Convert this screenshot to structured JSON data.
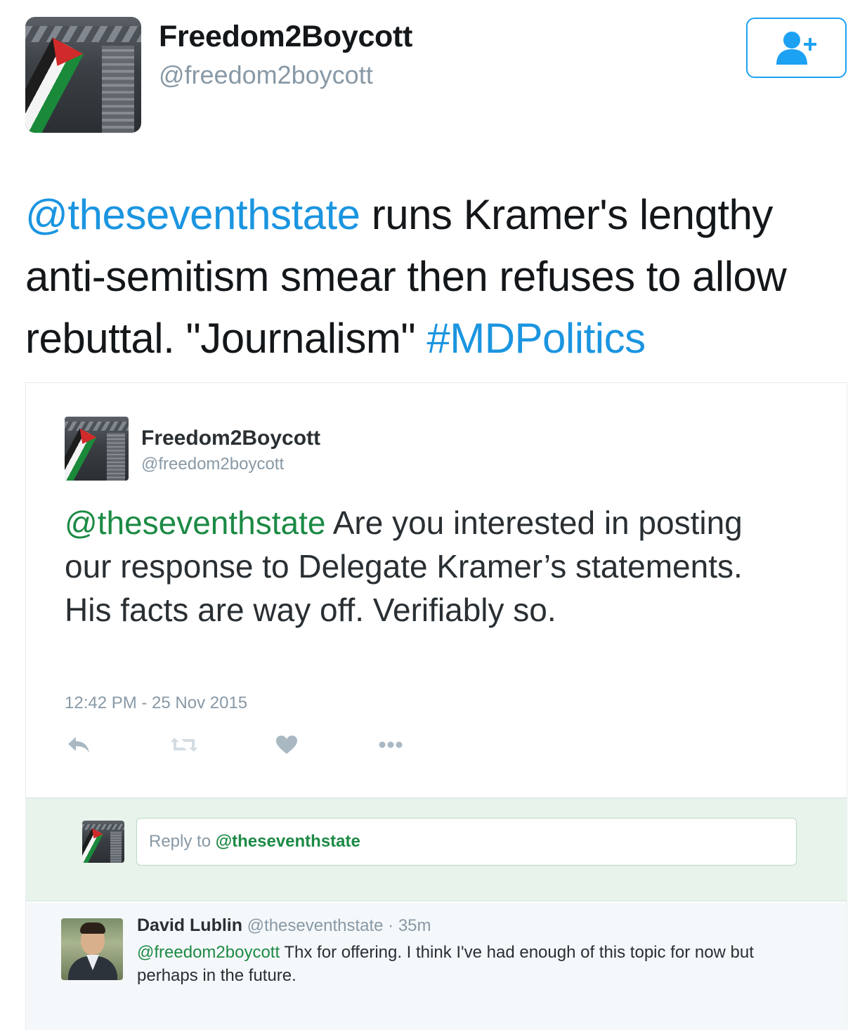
{
  "tweet": {
    "display_name": "Freedom2Boycott",
    "handle": "@freedom2boycott",
    "follow_button_icon": "add-user-icon",
    "text_mention": "@theseventhstate",
    "text_body": " runs Kramer's lengthy anti-semitism smear then refuses to allow rebuttal. \"Journalism\" ",
    "text_hashtag": "#MDPolitics"
  },
  "embedded": {
    "display_name": "Freedom2Boycott",
    "handle": "@freedom2boycott",
    "text_mention": "@theseventhstate",
    "text_body": " Are you interested in posting our response to Delegate Kramer’s statements. His facts are way off. Verifiably so.",
    "timestamp": "12:42 PM - 25 Nov 2015",
    "actions": [
      "reply-icon",
      "retweet-icon",
      "like-icon",
      "more-icon"
    ],
    "reply_box": {
      "prefix": "Reply to ",
      "mention": "@theseventhstate"
    },
    "reply": {
      "name": "David Lublin",
      "handle": "@theseventhstate",
      "separator": " · ",
      "age": "35m",
      "text_mention": "@freedom2boycott",
      "text_body": " Thx for offering. I think I've had enough of this topic for now but perhaps in the future."
    }
  },
  "colors": {
    "link_blue": "#1b95e0",
    "link_green": "#1c8a45",
    "muted": "#8899a6",
    "reply_bar_bg": "#e8f3ec"
  }
}
